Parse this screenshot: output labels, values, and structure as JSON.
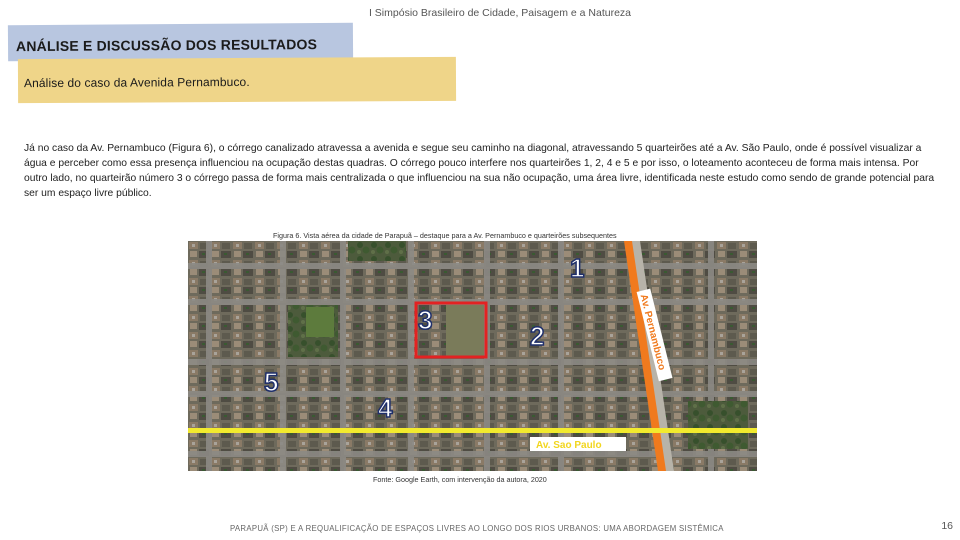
{
  "header": {
    "event": "I Simpósio Brasileiro de Cidade, Paisagem e a Natureza"
  },
  "section": {
    "title": "ANÁLISE E DISCUSSÃO DOS RESULTADOS",
    "subtitle": "Análise do caso da Avenida Pernambuco."
  },
  "body": {
    "paragraph": "Já no caso da Av. Pernambuco (Figura 6), o córrego canalizado atravessa a avenida e segue seu caminho na diagonal, atravessando 5 quarteirões até a Av. São Paulo, onde é possível visualizar a água e perceber como essa presença influenciou na ocupação destas quadras. O córrego pouco interfere nos quarteirões 1, 2, 4 e 5 e por isso, o loteamento aconteceu de forma mais intensa. Por outro lado, no quarteirão número 3 o córrego passa de forma mais centralizada o que influenciou na sua não ocupação, uma área livre, identificada neste estudo como sendo de grande potencial para ser um espaço livre público."
  },
  "figure": {
    "caption": "Figura 6. Vista aérea da cidade de Parapuã – destaque para a Av. Pernambuco e quarteirões subsequentes",
    "source": "Fonte: Google Earth, com intervenção da autora, 2020",
    "map": {
      "block_labels": [
        "1",
        "2",
        "3",
        "4",
        "5"
      ],
      "avenue_pernambuco": "Av. Pernambuco",
      "avenue_sao_paulo": "Av. Sao Paulo",
      "colors": {
        "orange_line": "#f07a1e",
        "yellow_line": "#f2ea2e",
        "highlight": "#e32222"
      }
    }
  },
  "footer": {
    "title": "PARAPUÃ (SP) E A REQUALIFICAÇÃO DE ESPAÇOS LIVRES AO LONGO DOS RIOS URBANOS: UMA ABORDAGEM SISTÊMICA",
    "page": "16"
  }
}
